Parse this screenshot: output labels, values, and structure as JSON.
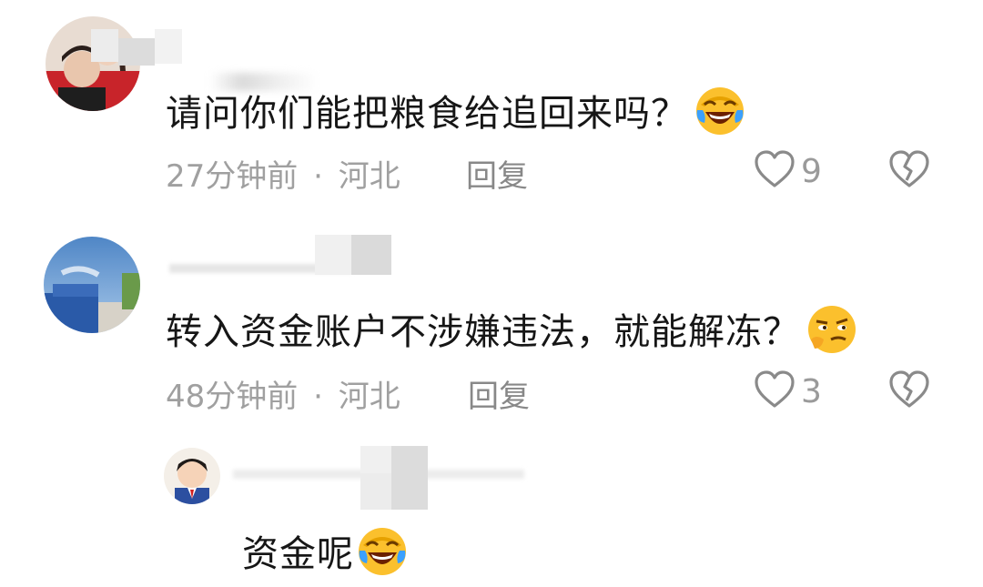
{
  "comments": [
    {
      "text": "请问你们能把粮食给追回来吗？",
      "emoji": "laughing-crying-emoji",
      "time": "27分钟前",
      "separator": "·",
      "location": "河北",
      "reply_label": "回复",
      "likes": "9"
    },
    {
      "text": "转入资金账户不涉嫌违法，就能解冻？",
      "emoji": "thinking-smirk-emoji",
      "time": "48分钟前",
      "separator": "·",
      "location": "河北",
      "reply_label": "回复",
      "likes": "3"
    }
  ],
  "reply": {
    "text": "资金呢",
    "emoji": "laughing-crying-emoji"
  },
  "icons": {
    "like": "heart-outline-icon",
    "dislike": "broken-heart-icon"
  },
  "colors": {
    "text": "#161616",
    "meta": "#a0a0a0",
    "icon": "#8a8a8a"
  }
}
